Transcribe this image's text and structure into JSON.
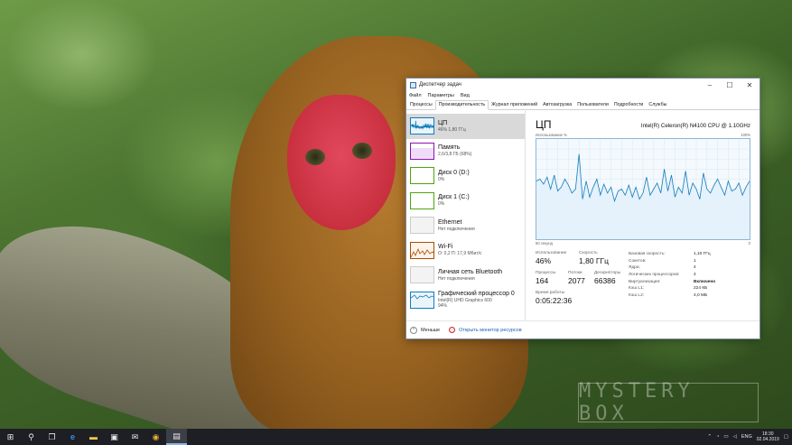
{
  "window": {
    "title": "Диспетчер задач",
    "controls": {
      "minimize": "–",
      "maximize": "☐",
      "close": "✕"
    },
    "menu": [
      "Файл",
      "Параметры",
      "Вид"
    ],
    "tabs": [
      "Процессы",
      "Производительность",
      "Журнал приложений",
      "Автозагрузка",
      "Пользователи",
      "Подробности",
      "Службы"
    ],
    "active_tab": "Производительность"
  },
  "sidebar": {
    "items": [
      {
        "name": "ЦП",
        "sub": "46% 1,80 ГГц",
        "color": "#117dbb"
      },
      {
        "name": "Память",
        "sub": "2,6/3,8 ГБ (68%)",
        "color": "#8b12ae"
      },
      {
        "name": "Диск 0 (D:)",
        "sub": "0%",
        "color": "#4da60c"
      },
      {
        "name": "Диск 1 (C:)",
        "sub": "0%",
        "color": "#4da60c"
      },
      {
        "name": "Ethernet",
        "sub": "Нет подключения",
        "color": "#a74f01"
      },
      {
        "name": "Wi-Fi",
        "sub": "О: 0,2 П: 17,9 Мбит/с",
        "color": "#a74f01"
      },
      {
        "name": "Личная сеть Bluetooth",
        "sub": "Нет подключения",
        "color": "#a74f01"
      },
      {
        "name": "Графический процессор 0",
        "sub": "Intel(R) UHD Graphics 600",
        "sub2": "94%",
        "color": "#117dbb"
      }
    ]
  },
  "main": {
    "title": "ЦП",
    "model": "Intel(R) Celeron(R) N4100 CPU @ 1.10GHz",
    "axis_top_left": "Использование %",
    "axis_top_right": "100%",
    "axis_bottom_left": "60 секунд",
    "axis_bottom_right": "0",
    "stats": {
      "usage_label": "Использование",
      "usage_value": "46%",
      "speed_label": "Скорость",
      "speed_value": "1,80 ГГц",
      "processes_label": "Процессы",
      "processes_value": "164",
      "threads_label": "Потоки",
      "threads_value": "2077",
      "handles_label": "Дескрипторы",
      "handles_value": "66386",
      "uptime_label": "Время работы",
      "uptime_value": "0:05:22:36"
    },
    "details": [
      {
        "key": "Базовая скорость:",
        "value": "1,10 ГГц"
      },
      {
        "key": "Сокетов:",
        "value": "1"
      },
      {
        "key": "Ядра:",
        "value": "4"
      },
      {
        "key": "Логических процессоров:",
        "value": "4"
      },
      {
        "key": "Виртуализация:",
        "value": "Включено"
      },
      {
        "key": "Кэш L1:",
        "value": "224 КБ"
      },
      {
        "key": "Кэш L2:",
        "value": "4,0 МБ"
      }
    ]
  },
  "footer": {
    "less_label": "Меньше",
    "monitor_label": "Открыть монитор ресурсов"
  },
  "cpu_history": [
    58,
    60,
    55,
    62,
    50,
    64,
    48,
    52,
    60,
    54,
    46,
    50,
    85,
    40,
    58,
    42,
    52,
    60,
    44,
    55,
    46,
    52,
    38,
    48,
    50,
    44,
    54,
    42,
    52,
    40,
    46,
    62,
    44,
    50,
    56,
    46,
    70,
    48,
    64,
    42,
    52,
    46,
    68,
    44,
    56,
    50,
    40,
    66,
    50,
    46,
    54,
    60,
    52,
    44,
    58,
    48,
    50,
    56,
    44,
    52,
    58
  ],
  "watermark": "MYSTERY BOX",
  "taskbar": {
    "lang": "ENG",
    "time": "18:30",
    "date": "02.04.2019"
  }
}
